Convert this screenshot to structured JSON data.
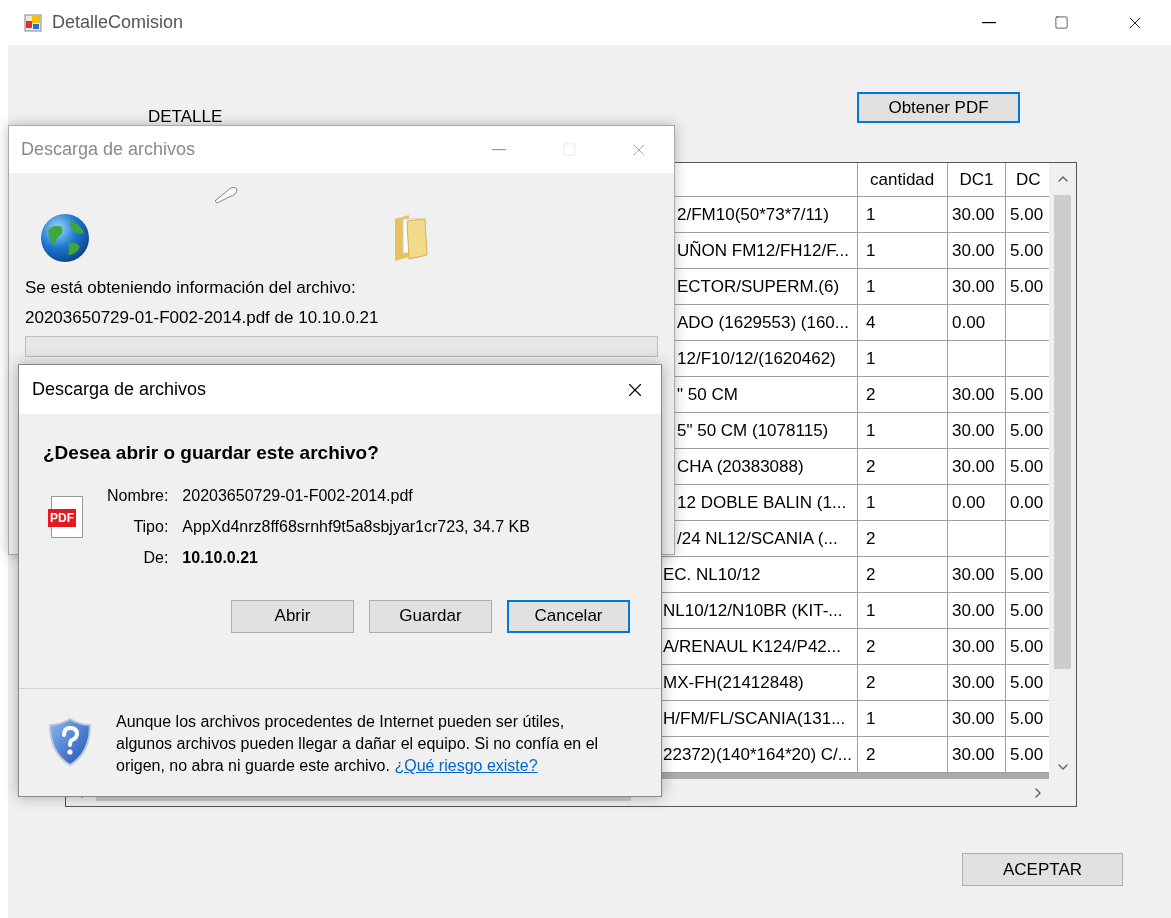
{
  "main_window": {
    "title": "DetalleComision",
    "label": "DETALLE",
    "pdf_button": "Obtener PDF",
    "accept_button": "ACEPTAR",
    "grid": {
      "columns": [
        "cantidad",
        "DC1",
        "DC"
      ],
      "rows": [
        {
          "column_1": "2/FM10(50*73*7/11)",
          "cantidad": "1",
          "dc1": "30.00",
          "dc2": "5.00"
        },
        {
          "column_1": "UÑON FM12/FH12/F...",
          "cantidad": "1",
          "dc1": "30.00",
          "dc2": "5.00"
        },
        {
          "column_1": "ECTOR/SUPERM.(6)",
          "cantidad": "1",
          "dc1": "30.00",
          "dc2": "5.00"
        },
        {
          "column_1": "ADO (1629553) (160...",
          "cantidad": "4",
          "dc1": "0.00"
        },
        {
          "column_1": "12/F10/12/(1620462)",
          "cantidad": "1"
        },
        {
          "column_1": "\" 50 CM",
          "cantidad": "2",
          "dc1": "30.00",
          "dc2": "5.00"
        },
        {
          "column_1": "5\" 50 CM (1078115)",
          "cantidad": "1",
          "dc1": "30.00",
          "dc2": "5.00"
        },
        {
          "column_1": "CHA (20383088)",
          "cantidad": "2",
          "dc1": "30.00",
          "dc2": "5.00"
        },
        {
          "column_1": "12 DOBLE BALIN (1...",
          "cantidad": "1",
          "dc1": "0.00",
          "dc2": "0.00"
        },
        {
          "column_1": "/24 NL12/SCANIA (...",
          "cantidad": "2"
        },
        {
          "column_1": "EC. NL10/12",
          "cantidad": "2",
          "dc1": "30.00",
          "dc2": "5.00"
        },
        {
          "column_1": "NL10/12/N10BR (KIT-...",
          "cantidad": "1",
          "dc1": "30.00",
          "dc2": "5.00"
        },
        {
          "column_1": "A/RENAUL K124/P42...",
          "cantidad": "2",
          "dc1": "30.00",
          "dc2": "5.00"
        },
        {
          "column_1": "MX-FH(21412848)",
          "cantidad": "2",
          "dc1": "30.00",
          "dc2": "5.00"
        },
        {
          "column_1": "H/FM/FL/SCANIA(131...",
          "cantidad": "1",
          "dc1": "30.00",
          "dc2": "5.00"
        },
        {
          "column_1": "22372)(140*164*20) C/...",
          "cantidad": "2",
          "dc1": "30.00",
          "dc2": "5.00"
        }
      ]
    }
  },
  "progress_dialog": {
    "title": "Descarga de archivos",
    "active": false,
    "status_text": "Se está obteniendo información del archivo:",
    "file_text": "20203650729-01-F002-2014.pdf de 10.10.0.21",
    "progress": {
      "level": 0
    }
  },
  "download_dialog": {
    "title": "Descarga de archivos",
    "active": true,
    "question": "¿Desea abrir o guardar este archivo?",
    "file_icon_label": "PDF",
    "fields": [
      {
        "label": "Nombre:",
        "value": "20203650729-01-F002-2014.pdf",
        "bold": false
      },
      {
        "label": "Tipo:",
        "value": "AppXd4nrz8ff68srnhf9t5a8sbjyar1cr723, 34.7 KB",
        "bold": false
      },
      {
        "label": "De:",
        "value": "10.10.0.21",
        "bold": true
      }
    ],
    "buttons": [
      {
        "label": "Abrir",
        "default": false
      },
      {
        "label": "Guardar",
        "default": false
      },
      {
        "label": "Cancelar",
        "default": true
      }
    ],
    "warning": "Aunque los archivos procedentes de Internet pueden ser útiles, algunos archivos pueden llegar a dañar el equipo. Si no confía en el origen, no abra ni guarde este archivo.",
    "link": "¿Qué riesgo existe?"
  }
}
